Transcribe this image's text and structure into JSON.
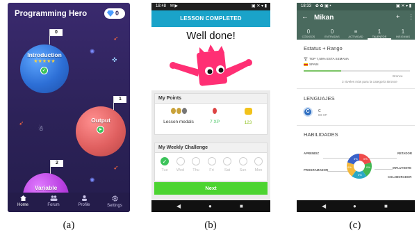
{
  "panel_a": {
    "app_title": "Programming Hero",
    "gem_count": "0",
    "planets": [
      {
        "label": "Introduction",
        "flag": "0",
        "stars": "★★★★★"
      },
      {
        "label": "Output",
        "flag": "1"
      },
      {
        "label": "Variable",
        "flag": "2"
      }
    ],
    "tabs": [
      {
        "label": "Home",
        "icon": "home-icon"
      },
      {
        "label": "Forum",
        "icon": "people-icon"
      },
      {
        "label": "Profile",
        "icon": "person-icon"
      },
      {
        "label": "Settings",
        "icon": "gear-icon"
      }
    ],
    "caption": "(a)"
  },
  "panel_b": {
    "status_time": "18:48",
    "banner": "LESSON COMPLETED",
    "heading": "Well done!",
    "points_title": "My Points",
    "medals_label": "Lesson medals",
    "xp_value": "7 XP",
    "coin_value": "123",
    "challenge_title": "My Weekly Challenge",
    "days": [
      "Tue",
      "Wed",
      "Thu",
      "Fri",
      "Sat",
      "Sun",
      "Mon"
    ],
    "completed_days": 1,
    "next_label": "Next",
    "caption": "(b)",
    "colors": {
      "banner": "#1aa3c9",
      "next": "#4cd431",
      "xp": "#3cc35a",
      "coins": "#8fc21f"
    }
  },
  "panel_c": {
    "status_time": "18:33",
    "title": "Mikan",
    "stats": [
      {
        "n": "0",
        "l": "CÓDIGOS"
      },
      {
        "n": "0",
        "l": "ENTRADAS"
      },
      {
        "n": "≡",
        "l": "ACTIVIDAD"
      },
      {
        "n": "1",
        "l": "TALENTOS"
      },
      {
        "n": "1",
        "l": "INSIGNIAS"
      }
    ],
    "active_stat": 3,
    "status_title": "Estatus + Rango",
    "top_line": "TOP 7,55% ESTA SEMANA",
    "country": "SPAIN",
    "rank_label": "Bronce",
    "rank_progress": 0.35,
    "next_rank_text": "3 niveles más para la categoría Bronce",
    "languages_title": "LENGUAJES",
    "language": {
      "badge": "C",
      "name": "C",
      "xp": "83 XP"
    },
    "skills_title": "HABILIDADES",
    "skills": [
      "APRENDIZ",
      "RETADOR",
      "PROGRAMADOR",
      "INFLUYENTE",
      "COLABORADOR"
    ],
    "pie_values": [
      "3%",
      "0%",
      "0%",
      "0%",
      "0%"
    ],
    "caption": "(c)"
  }
}
